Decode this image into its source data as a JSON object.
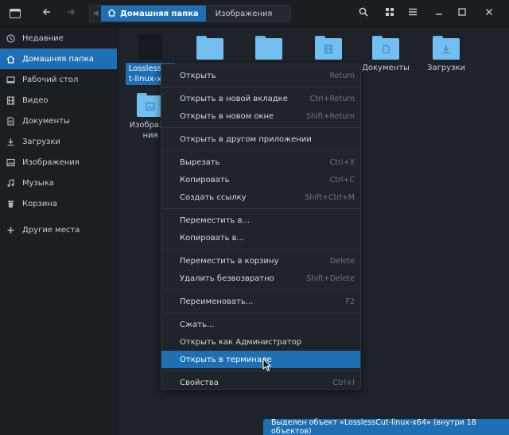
{
  "header": {
    "back_icon": "arrow-left-icon",
    "forward_icon": "arrow-right-icon",
    "crumbs": {
      "home": "Домашняя папка",
      "next": "Изображения"
    }
  },
  "sidebar": {
    "items": [
      {
        "label": "Недавние",
        "icon": "clock-icon"
      },
      {
        "label": "Домашняя папка",
        "icon": "home-icon"
      },
      {
        "label": "Рабочий стол",
        "icon": "desktop-icon"
      },
      {
        "label": "Видео",
        "icon": "film-icon"
      },
      {
        "label": "Документы",
        "icon": "document-icon"
      },
      {
        "label": "Загрузки",
        "icon": "download-icon"
      },
      {
        "label": "Изображения",
        "icon": "image-icon"
      },
      {
        "label": "Музыка",
        "icon": "music-icon"
      },
      {
        "label": "Корзина",
        "icon": "trash-icon"
      },
      {
        "label": "Другие места",
        "icon": "plus-icon"
      }
    ]
  },
  "files": {
    "selected": "LosslessCut-linux-x64",
    "documents": "Документы",
    "downloads": "Загрузки",
    "images": "Изображения"
  },
  "context_menu": {
    "items": [
      {
        "label": "Открыть",
        "shortcut": "Return"
      },
      {
        "label": "Открыть в новой вкладке",
        "shortcut": "Ctrl+Return"
      },
      {
        "label": "Открыть в новом окне",
        "shortcut": "Shift+Return"
      },
      {
        "label": "Открыть в другом приложении",
        "shortcut": ""
      },
      {
        "label": "Вырезать",
        "shortcut": "Ctrl+X"
      },
      {
        "label": "Копировать",
        "shortcut": "Ctrl+C"
      },
      {
        "label": "Создать ссылку",
        "shortcut": "Shift+Ctrl+M"
      },
      {
        "label": "Переместить в...",
        "shortcut": ""
      },
      {
        "label": "Копировать в...",
        "shortcut": ""
      },
      {
        "label": "Переместить в корзину",
        "shortcut": "Delete"
      },
      {
        "label": "Удалить безвозвратно",
        "shortcut": "Shift+Delete"
      },
      {
        "label": "Переименовать...",
        "shortcut": "F2"
      },
      {
        "label": "Сжать...",
        "shortcut": ""
      },
      {
        "label": "Открыть как Администратор",
        "shortcut": ""
      },
      {
        "label": "Открыть в терминале",
        "shortcut": ""
      },
      {
        "label": "Свойства",
        "shortcut": "Ctrl+I"
      }
    ]
  },
  "status": "Выделен объект «LosslessCut-linux-x64» (внутри 18 объектов)",
  "colors": {
    "accent": "#1f6fb5",
    "folder": "#72bff0",
    "background": "#1e2329"
  }
}
